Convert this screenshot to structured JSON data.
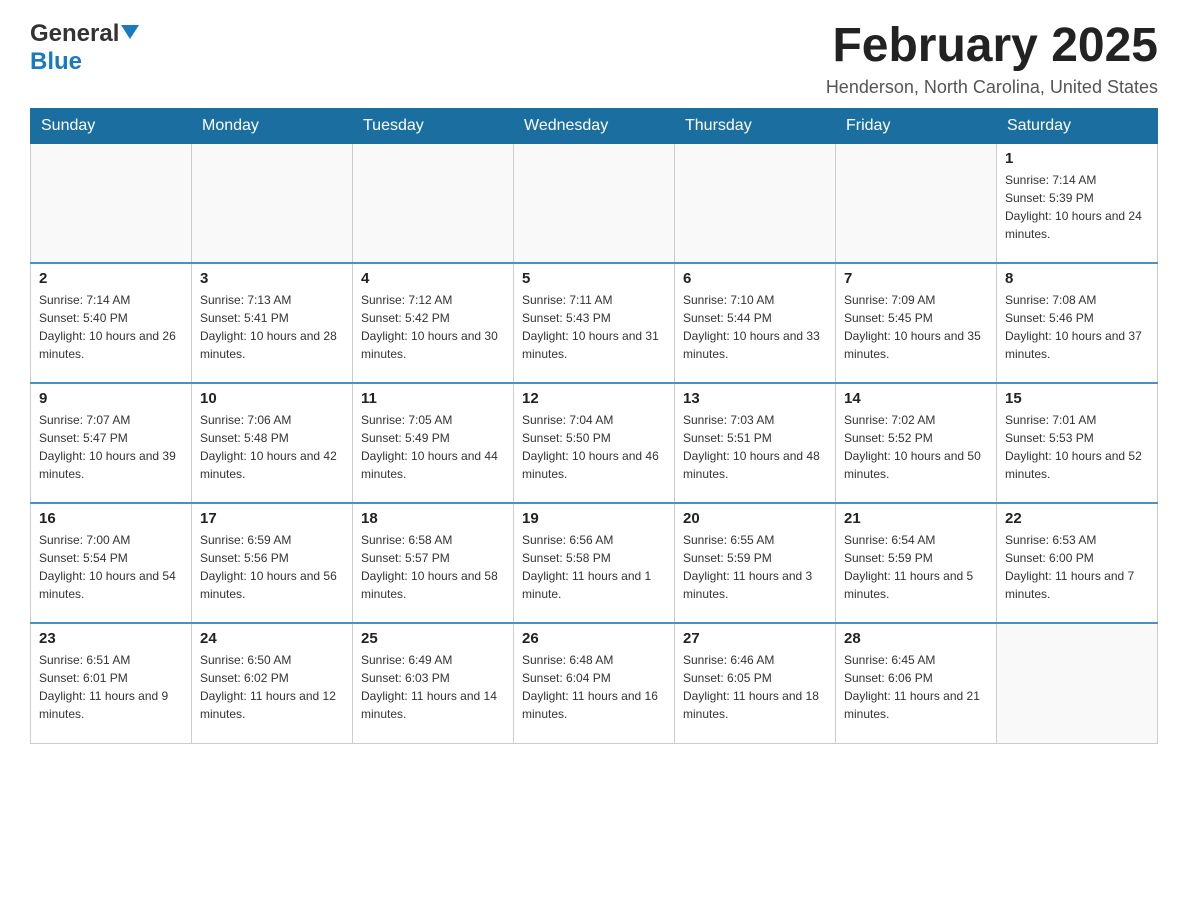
{
  "logo": {
    "general": "General",
    "blue": "Blue"
  },
  "header": {
    "title": "February 2025",
    "subtitle": "Henderson, North Carolina, United States"
  },
  "days_of_week": [
    "Sunday",
    "Monday",
    "Tuesday",
    "Wednesday",
    "Thursday",
    "Friday",
    "Saturday"
  ],
  "weeks": [
    [
      {
        "day": "",
        "info": ""
      },
      {
        "day": "",
        "info": ""
      },
      {
        "day": "",
        "info": ""
      },
      {
        "day": "",
        "info": ""
      },
      {
        "day": "",
        "info": ""
      },
      {
        "day": "",
        "info": ""
      },
      {
        "day": "1",
        "info": "Sunrise: 7:14 AM\nSunset: 5:39 PM\nDaylight: 10 hours and 24 minutes."
      }
    ],
    [
      {
        "day": "2",
        "info": "Sunrise: 7:14 AM\nSunset: 5:40 PM\nDaylight: 10 hours and 26 minutes."
      },
      {
        "day": "3",
        "info": "Sunrise: 7:13 AM\nSunset: 5:41 PM\nDaylight: 10 hours and 28 minutes."
      },
      {
        "day": "4",
        "info": "Sunrise: 7:12 AM\nSunset: 5:42 PM\nDaylight: 10 hours and 30 minutes."
      },
      {
        "day": "5",
        "info": "Sunrise: 7:11 AM\nSunset: 5:43 PM\nDaylight: 10 hours and 31 minutes."
      },
      {
        "day": "6",
        "info": "Sunrise: 7:10 AM\nSunset: 5:44 PM\nDaylight: 10 hours and 33 minutes."
      },
      {
        "day": "7",
        "info": "Sunrise: 7:09 AM\nSunset: 5:45 PM\nDaylight: 10 hours and 35 minutes."
      },
      {
        "day": "8",
        "info": "Sunrise: 7:08 AM\nSunset: 5:46 PM\nDaylight: 10 hours and 37 minutes."
      }
    ],
    [
      {
        "day": "9",
        "info": "Sunrise: 7:07 AM\nSunset: 5:47 PM\nDaylight: 10 hours and 39 minutes."
      },
      {
        "day": "10",
        "info": "Sunrise: 7:06 AM\nSunset: 5:48 PM\nDaylight: 10 hours and 42 minutes."
      },
      {
        "day": "11",
        "info": "Sunrise: 7:05 AM\nSunset: 5:49 PM\nDaylight: 10 hours and 44 minutes."
      },
      {
        "day": "12",
        "info": "Sunrise: 7:04 AM\nSunset: 5:50 PM\nDaylight: 10 hours and 46 minutes."
      },
      {
        "day": "13",
        "info": "Sunrise: 7:03 AM\nSunset: 5:51 PM\nDaylight: 10 hours and 48 minutes."
      },
      {
        "day": "14",
        "info": "Sunrise: 7:02 AM\nSunset: 5:52 PM\nDaylight: 10 hours and 50 minutes."
      },
      {
        "day": "15",
        "info": "Sunrise: 7:01 AM\nSunset: 5:53 PM\nDaylight: 10 hours and 52 minutes."
      }
    ],
    [
      {
        "day": "16",
        "info": "Sunrise: 7:00 AM\nSunset: 5:54 PM\nDaylight: 10 hours and 54 minutes."
      },
      {
        "day": "17",
        "info": "Sunrise: 6:59 AM\nSunset: 5:56 PM\nDaylight: 10 hours and 56 minutes."
      },
      {
        "day": "18",
        "info": "Sunrise: 6:58 AM\nSunset: 5:57 PM\nDaylight: 10 hours and 58 minutes."
      },
      {
        "day": "19",
        "info": "Sunrise: 6:56 AM\nSunset: 5:58 PM\nDaylight: 11 hours and 1 minute."
      },
      {
        "day": "20",
        "info": "Sunrise: 6:55 AM\nSunset: 5:59 PM\nDaylight: 11 hours and 3 minutes."
      },
      {
        "day": "21",
        "info": "Sunrise: 6:54 AM\nSunset: 5:59 PM\nDaylight: 11 hours and 5 minutes."
      },
      {
        "day": "22",
        "info": "Sunrise: 6:53 AM\nSunset: 6:00 PM\nDaylight: 11 hours and 7 minutes."
      }
    ],
    [
      {
        "day": "23",
        "info": "Sunrise: 6:51 AM\nSunset: 6:01 PM\nDaylight: 11 hours and 9 minutes."
      },
      {
        "day": "24",
        "info": "Sunrise: 6:50 AM\nSunset: 6:02 PM\nDaylight: 11 hours and 12 minutes."
      },
      {
        "day": "25",
        "info": "Sunrise: 6:49 AM\nSunset: 6:03 PM\nDaylight: 11 hours and 14 minutes."
      },
      {
        "day": "26",
        "info": "Sunrise: 6:48 AM\nSunset: 6:04 PM\nDaylight: 11 hours and 16 minutes."
      },
      {
        "day": "27",
        "info": "Sunrise: 6:46 AM\nSunset: 6:05 PM\nDaylight: 11 hours and 18 minutes."
      },
      {
        "day": "28",
        "info": "Sunrise: 6:45 AM\nSunset: 6:06 PM\nDaylight: 11 hours and 21 minutes."
      },
      {
        "day": "",
        "info": ""
      }
    ]
  ]
}
